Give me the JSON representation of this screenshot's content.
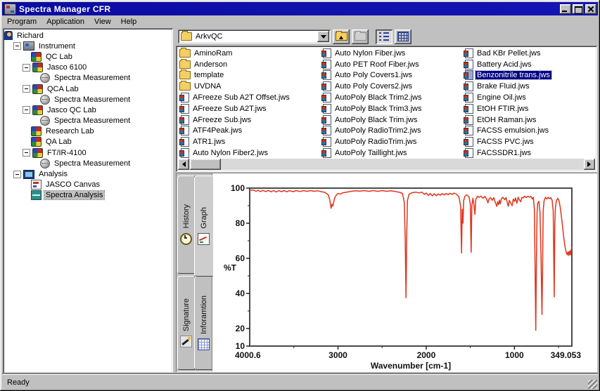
{
  "window": {
    "title": "Spectra Manager CFR",
    "status": "Ready"
  },
  "menu": {
    "items": [
      "Program",
      "Application",
      "View",
      "Help"
    ]
  },
  "tree": {
    "items": [
      {
        "label": "Richard",
        "depth": 0,
        "icon": "person",
        "icon_name": "user-icon",
        "expander": false,
        "selected": false
      },
      {
        "label": "Instrument",
        "depth": 1,
        "icon": "instrument",
        "icon_name": "instrument-icon",
        "expander": true,
        "selected": false
      },
      {
        "label": "QC Lab",
        "depth": 2,
        "icon": "lab",
        "icon_name": "lab-icon",
        "expander": false,
        "selected": false
      },
      {
        "label": "Jasco 6100",
        "depth": 2,
        "icon": "lab",
        "icon_name": "lab-icon",
        "expander": true,
        "selected": false
      },
      {
        "label": "Spectra Measurement",
        "depth": 3,
        "icon": "sphere",
        "icon_name": "spectra-measurement-icon",
        "expander": false,
        "selected": false
      },
      {
        "label": "QCA Lab",
        "depth": 2,
        "icon": "lab",
        "icon_name": "lab-icon",
        "expander": true,
        "selected": false
      },
      {
        "label": "Spectra Measurement",
        "depth": 3,
        "icon": "sphere",
        "icon_name": "spectra-measurement-icon",
        "expander": false,
        "selected": false
      },
      {
        "label": "Jasco QC Lab",
        "depth": 2,
        "icon": "lab",
        "icon_name": "lab-icon",
        "expander": true,
        "selected": false
      },
      {
        "label": "Spectra Measurement",
        "depth": 3,
        "icon": "sphere",
        "icon_name": "spectra-measurement-icon",
        "expander": false,
        "selected": false
      },
      {
        "label": "Research Lab",
        "depth": 2,
        "icon": "lab",
        "icon_name": "lab-icon",
        "expander": false,
        "selected": false
      },
      {
        "label": "QA Lab",
        "depth": 2,
        "icon": "lab",
        "icon_name": "lab-icon",
        "expander": false,
        "selected": false
      },
      {
        "label": "FT/IR-4100",
        "depth": 2,
        "icon": "lab",
        "icon_name": "lab-icon",
        "expander": true,
        "selected": false
      },
      {
        "label": "Spectra Measurement",
        "depth": 3,
        "icon": "sphere",
        "icon_name": "spectra-measurement-icon",
        "expander": false,
        "selected": false
      },
      {
        "label": "Analysis",
        "depth": 1,
        "icon": "analysis",
        "icon_name": "analysis-icon",
        "expander": true,
        "selected": false
      },
      {
        "label": "JASCO Canvas",
        "depth": 2,
        "icon": "canvas",
        "icon_name": "jasco-canvas-icon",
        "expander": false,
        "selected": false
      },
      {
        "label": "Spectra Analysis",
        "depth": 2,
        "icon": "spectra",
        "icon_name": "spectra-analysis-icon",
        "expander": false,
        "selected": true
      }
    ]
  },
  "file_browser": {
    "path": "ArkvQC",
    "toolbar_buttons": [
      {
        "name": "up-one-level",
        "icon": "folder-up-icon",
        "disabled": false,
        "pressed": false
      },
      {
        "name": "create-new-folder",
        "icon": "new-folder-icon",
        "disabled": true,
        "pressed": false
      },
      {
        "name": "list-view",
        "icon": "list-view-icon",
        "disabled": false,
        "pressed": true
      },
      {
        "name": "details-view",
        "icon": "details-view-icon",
        "disabled": false,
        "pressed": false
      }
    ],
    "columns": [
      {
        "items": [
          {
            "name": "AminoRam",
            "type": "folder",
            "selected": false
          },
          {
            "name": "Anderson",
            "type": "folder",
            "selected": false
          },
          {
            "name": "template",
            "type": "folder",
            "selected": false
          },
          {
            "name": "UVDNA",
            "type": "folder",
            "selected": false
          },
          {
            "name": "AFreeze Sub A2T Offset.jws",
            "type": "jws",
            "selected": false
          },
          {
            "name": "AFreeze Sub A2T.jws",
            "type": "jws",
            "selected": false
          },
          {
            "name": "AFreeze Sub.jws",
            "type": "jws",
            "selected": false
          },
          {
            "name": "ATF4Peak.jws",
            "type": "jws",
            "selected": false
          },
          {
            "name": "ATR1.jws",
            "type": "jws",
            "selected": false
          },
          {
            "name": "Auto Nylon Fiber2.jws",
            "type": "jws",
            "selected": false
          }
        ]
      },
      {
        "items": [
          {
            "name": "Auto Nylon Fiber.jws",
            "type": "jws",
            "selected": false
          },
          {
            "name": "Auto PET Roof Fiber.jws",
            "type": "jws",
            "selected": false
          },
          {
            "name": "Auto Poly Covers1.jws",
            "type": "jws",
            "selected": false
          },
          {
            "name": "Auto Poly Covers2.jws",
            "type": "jws",
            "selected": false
          },
          {
            "name": "AutoPoly Black Trim2.jws",
            "type": "jws",
            "selected": false
          },
          {
            "name": "AutoPoly Black Trim3.jws",
            "type": "jws",
            "selected": false
          },
          {
            "name": "AutoPoly Black Trim.jws",
            "type": "jws",
            "selected": false
          },
          {
            "name": "AutoPoly RadioTrim2.jws",
            "type": "jws",
            "selected": false
          },
          {
            "name": "AutoPoly RadioTrim.jws",
            "type": "jws",
            "selected": false
          },
          {
            "name": "AutoPoly Taillight.jws",
            "type": "jws",
            "selected": false
          }
        ]
      },
      {
        "items": [
          {
            "name": "Bad KBr Pellet.jws",
            "type": "jws",
            "selected": false
          },
          {
            "name": "Battery Acid.jws",
            "type": "jws",
            "selected": false
          },
          {
            "name": "Benzonitrile trans.jws",
            "type": "jws",
            "selected": true
          },
          {
            "name": "Brake Fluid.jws",
            "type": "jws",
            "selected": false
          },
          {
            "name": "Engine Oil.jws",
            "type": "jws",
            "selected": false
          },
          {
            "name": "EtOH FTIR.jws",
            "type": "jws",
            "selected": false
          },
          {
            "name": "EtOH Raman.jws",
            "type": "jws",
            "selected": false
          },
          {
            "name": "FACSS emulsion.jws",
            "type": "jws",
            "selected": false
          },
          {
            "name": "FACSS PVC.jws",
            "type": "jws",
            "selected": false
          },
          {
            "name": "FACSSDR1.jws",
            "type": "jws",
            "selected": false
          }
        ]
      }
    ]
  },
  "tabs": {
    "items": [
      {
        "label": "History",
        "icon": "history-icon",
        "active": false
      },
      {
        "label": "Graph",
        "icon": "graph-icon",
        "active": true
      },
      {
        "label": "Signature",
        "icon": "signature-icon",
        "active": false
      },
      {
        "label": "Inforamtion",
        "icon": "information-icon",
        "active": false
      }
    ]
  },
  "colors": {
    "titlebar": "#0c0ca2",
    "chrome": "#c0c0c0",
    "selection": "#000080",
    "spectrum_line": "#e0341c",
    "folder_yellow": "#f4cf63"
  },
  "chart_data": {
    "type": "line",
    "xlabel": "Wavenumber [cm-1]",
    "ylabel": "%T",
    "x_start": 4000.6,
    "x_end": 349.053,
    "x_start_label": "4000.6",
    "x_end_label": "349.053",
    "x_ticks": [
      {
        "v": 3000,
        "label": "3000"
      },
      {
        "v": 2000,
        "label": "2000"
      },
      {
        "v": 1000,
        "label": "1000"
      }
    ],
    "x_minor_ticks": [
      3500,
      2500,
      1500,
      500
    ],
    "y_min": 10,
    "y_max": 100,
    "y_ticks": [
      {
        "v": 100,
        "label": "100"
      },
      {
        "v": 80,
        "label": "80"
      },
      {
        "v": 60,
        "label": "60"
      },
      {
        "v": 40,
        "label": "40"
      },
      {
        "v": 20,
        "label": "20"
      },
      {
        "v": 10,
        "label": "10"
      }
    ],
    "y_minor_ticks": [
      90,
      70,
      50,
      30
    ],
    "line_color": "#e0341c",
    "grid": false,
    "points": [
      [
        4000.6,
        98.8
      ],
      [
        3960,
        98.9
      ],
      [
        3930,
        98.2
      ],
      [
        3905,
        98.8
      ],
      [
        3880,
        98.1
      ],
      [
        3850,
        98.7
      ],
      [
        3820,
        98.0
      ],
      [
        3790,
        98.7
      ],
      [
        3760,
        97.9
      ],
      [
        3730,
        98.6
      ],
      [
        3700,
        97.8
      ],
      [
        3670,
        98.6
      ],
      [
        3640,
        98.0
      ],
      [
        3610,
        98.6
      ],
      [
        3580,
        97.9
      ],
      [
        3550,
        98.6
      ],
      [
        3510,
        98.0
      ],
      [
        3470,
        98.6
      ],
      [
        3430,
        98.1
      ],
      [
        3390,
        98.6
      ],
      [
        3350,
        98.2
      ],
      [
        3310,
        98.6
      ],
      [
        3270,
        98.2
      ],
      [
        3230,
        98.5
      ],
      [
        3190,
        98.0
      ],
      [
        3150,
        97.6
      ],
      [
        3110,
        96.2
      ],
      [
        3092,
        93.0
      ],
      [
        3078,
        88.5
      ],
      [
        3068,
        90.8
      ],
      [
        3058,
        89.8
      ],
      [
        3040,
        94.0
      ],
      [
        3020,
        96.0
      ],
      [
        3000,
        97.0
      ],
      [
        2975,
        96.6
      ],
      [
        2950,
        97.3
      ],
      [
        2900,
        97.7
      ],
      [
        2850,
        98.2
      ],
      [
        2800,
        98.5
      ],
      [
        2750,
        98.3
      ],
      [
        2700,
        98.6
      ],
      [
        2650,
        98.2
      ],
      [
        2600,
        98.6
      ],
      [
        2550,
        98.2
      ],
      [
        2500,
        98.6
      ],
      [
        2450,
        98.2
      ],
      [
        2400,
        98.5
      ],
      [
        2350,
        98.1
      ],
      [
        2300,
        97.6
      ],
      [
        2270,
        97.0
      ],
      [
        2248,
        92.0
      ],
      [
        2238,
        70.0
      ],
      [
        2229,
        37.5
      ],
      [
        2221,
        72.0
      ],
      [
        2212,
        93.0
      ],
      [
        2195,
        96.5
      ],
      [
        2160,
        97.4
      ],
      [
        2120,
        97.7
      ],
      [
        2080,
        97.3
      ],
      [
        2050,
        97.7
      ],
      [
        2020,
        96.4
      ],
      [
        2000,
        97.2
      ],
      [
        1975,
        95.8
      ],
      [
        1955,
        96.9
      ],
      [
        1930,
        95.6
      ],
      [
        1910,
        96.8
      ],
      [
        1885,
        95.7
      ],
      [
        1865,
        96.7
      ],
      [
        1840,
        95.9
      ],
      [
        1820,
        96.9
      ],
      [
        1795,
        96.1
      ],
      [
        1775,
        97.0
      ],
      [
        1750,
        96.3
      ],
      [
        1730,
        97.1
      ],
      [
        1705,
        96.4
      ],
      [
        1685,
        97.2
      ],
      [
        1660,
        96.6
      ],
      [
        1630,
        95.2
      ],
      [
        1610,
        90.0
      ],
      [
        1599,
        63.0
      ],
      [
        1592,
        88.0
      ],
      [
        1583,
        80.0
      ],
      [
        1575,
        93.0
      ],
      [
        1560,
        95.5
      ],
      [
        1540,
        96.2
      ],
      [
        1515,
        95.0
      ],
      [
        1500,
        91.0
      ],
      [
        1491,
        63.5
      ],
      [
        1483,
        90.0
      ],
      [
        1470,
        94.3
      ],
      [
        1458,
        90.0
      ],
      [
        1448,
        85.0
      ],
      [
        1438,
        93.5
      ],
      [
        1420,
        95.4
      ],
      [
        1400,
        94.7
      ],
      [
        1380,
        95.5
      ],
      [
        1355,
        94.2
      ],
      [
        1335,
        95.3
      ],
      [
        1315,
        93.8
      ],
      [
        1300,
        91.6
      ],
      [
        1288,
        93.8
      ],
      [
        1270,
        94.6
      ],
      [
        1252,
        93.0
      ],
      [
        1235,
        94.6
      ],
      [
        1218,
        92.0
      ],
      [
        1200,
        89.6
      ],
      [
        1190,
        92.2
      ],
      [
        1180,
        90.6
      ],
      [
        1170,
        93.2
      ],
      [
        1160,
        91.0
      ],
      [
        1148,
        94.0
      ],
      [
        1130,
        94.8
      ],
      [
        1110,
        93.4
      ],
      [
        1095,
        94.6
      ],
      [
        1070,
        89.6
      ],
      [
        1058,
        93.0
      ],
      [
        1042,
        91.4
      ],
      [
        1026,
        90.0
      ],
      [
        1012,
        93.8
      ],
      [
        1000,
        92.4
      ],
      [
        988,
        94.4
      ],
      [
        972,
        91.4
      ],
      [
        958,
        94.8
      ],
      [
        940,
        93.0
      ],
      [
        928,
        92.2
      ],
      [
        916,
        94.8
      ],
      [
        900,
        94.4
      ],
      [
        884,
        95.4
      ],
      [
        866,
        94.6
      ],
      [
        848,
        95.4
      ],
      [
        830,
        94.8
      ],
      [
        812,
        95.3
      ],
      [
        797,
        93.8
      ],
      [
        786,
        94.8
      ],
      [
        774,
        88.0
      ],
      [
        766,
        55.0
      ],
      [
        758,
        19.0
      ],
      [
        751,
        58.0
      ],
      [
        744,
        86.0
      ],
      [
        736,
        91.5
      ],
      [
        722,
        92.5
      ],
      [
        710,
        86.0
      ],
      [
        700,
        64.0
      ],
      [
        688,
        28.0
      ],
      [
        681,
        55.0
      ],
      [
        674,
        87.0
      ],
      [
        663,
        93.0
      ],
      [
        648,
        94.8
      ],
      [
        633,
        93.8
      ],
      [
        618,
        94.8
      ],
      [
        603,
        93.9
      ],
      [
        588,
        94.6
      ],
      [
        572,
        93.0
      ],
      [
        560,
        87.0
      ],
      [
        549,
        38.0
      ],
      [
        543,
        78.0
      ],
      [
        536,
        89.0
      ],
      [
        524,
        92.8
      ],
      [
        510,
        94.2
      ],
      [
        496,
        93.0
      ],
      [
        482,
        89.5
      ],
      [
        468,
        84.0
      ],
      [
        455,
        78.5
      ],
      [
        442,
        72.5
      ],
      [
        428,
        67.0
      ],
      [
        414,
        63.5
      ],
      [
        402,
        62.0
      ],
      [
        392,
        63.8
      ],
      [
        383,
        61.6
      ],
      [
        374,
        64.2
      ],
      [
        365,
        62.0
      ],
      [
        357,
        64.8
      ],
      [
        349.053,
        66.2
      ]
    ]
  }
}
